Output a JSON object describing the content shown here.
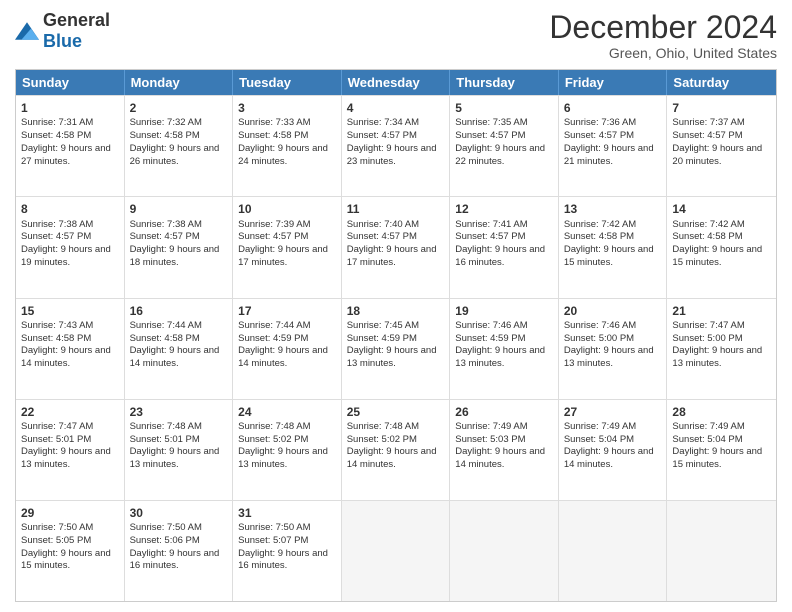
{
  "logo": {
    "general": "General",
    "blue": "Blue"
  },
  "header": {
    "month": "December 2024",
    "location": "Green, Ohio, United States"
  },
  "days": [
    "Sunday",
    "Monday",
    "Tuesday",
    "Wednesday",
    "Thursday",
    "Friday",
    "Saturday"
  ],
  "weeks": [
    [
      {
        "day": "1",
        "sunrise": "7:31 AM",
        "sunset": "4:58 PM",
        "daylight": "9 hours and 27 minutes."
      },
      {
        "day": "2",
        "sunrise": "7:32 AM",
        "sunset": "4:58 PM",
        "daylight": "9 hours and 26 minutes."
      },
      {
        "day": "3",
        "sunrise": "7:33 AM",
        "sunset": "4:58 PM",
        "daylight": "9 hours and 24 minutes."
      },
      {
        "day": "4",
        "sunrise": "7:34 AM",
        "sunset": "4:57 PM",
        "daylight": "9 hours and 23 minutes."
      },
      {
        "day": "5",
        "sunrise": "7:35 AM",
        "sunset": "4:57 PM",
        "daylight": "9 hours and 22 minutes."
      },
      {
        "day": "6",
        "sunrise": "7:36 AM",
        "sunset": "4:57 PM",
        "daylight": "9 hours and 21 minutes."
      },
      {
        "day": "7",
        "sunrise": "7:37 AM",
        "sunset": "4:57 PM",
        "daylight": "9 hours and 20 minutes."
      }
    ],
    [
      {
        "day": "8",
        "sunrise": "7:38 AM",
        "sunset": "4:57 PM",
        "daylight": "9 hours and 19 minutes."
      },
      {
        "day": "9",
        "sunrise": "7:38 AM",
        "sunset": "4:57 PM",
        "daylight": "9 hours and 18 minutes."
      },
      {
        "day": "10",
        "sunrise": "7:39 AM",
        "sunset": "4:57 PM",
        "daylight": "9 hours and 17 minutes."
      },
      {
        "day": "11",
        "sunrise": "7:40 AM",
        "sunset": "4:57 PM",
        "daylight": "9 hours and 17 minutes."
      },
      {
        "day": "12",
        "sunrise": "7:41 AM",
        "sunset": "4:57 PM",
        "daylight": "9 hours and 16 minutes."
      },
      {
        "day": "13",
        "sunrise": "7:42 AM",
        "sunset": "4:58 PM",
        "daylight": "9 hours and 15 minutes."
      },
      {
        "day": "14",
        "sunrise": "7:42 AM",
        "sunset": "4:58 PM",
        "daylight": "9 hours and 15 minutes."
      }
    ],
    [
      {
        "day": "15",
        "sunrise": "7:43 AM",
        "sunset": "4:58 PM",
        "daylight": "9 hours and 14 minutes."
      },
      {
        "day": "16",
        "sunrise": "7:44 AM",
        "sunset": "4:58 PM",
        "daylight": "9 hours and 14 minutes."
      },
      {
        "day": "17",
        "sunrise": "7:44 AM",
        "sunset": "4:59 PM",
        "daylight": "9 hours and 14 minutes."
      },
      {
        "day": "18",
        "sunrise": "7:45 AM",
        "sunset": "4:59 PM",
        "daylight": "9 hours and 13 minutes."
      },
      {
        "day": "19",
        "sunrise": "7:46 AM",
        "sunset": "4:59 PM",
        "daylight": "9 hours and 13 minutes."
      },
      {
        "day": "20",
        "sunrise": "7:46 AM",
        "sunset": "5:00 PM",
        "daylight": "9 hours and 13 minutes."
      },
      {
        "day": "21",
        "sunrise": "7:47 AM",
        "sunset": "5:00 PM",
        "daylight": "9 hours and 13 minutes."
      }
    ],
    [
      {
        "day": "22",
        "sunrise": "7:47 AM",
        "sunset": "5:01 PM",
        "daylight": "9 hours and 13 minutes."
      },
      {
        "day": "23",
        "sunrise": "7:48 AM",
        "sunset": "5:01 PM",
        "daylight": "9 hours and 13 minutes."
      },
      {
        "day": "24",
        "sunrise": "7:48 AM",
        "sunset": "5:02 PM",
        "daylight": "9 hours and 13 minutes."
      },
      {
        "day": "25",
        "sunrise": "7:48 AM",
        "sunset": "5:02 PM",
        "daylight": "9 hours and 14 minutes."
      },
      {
        "day": "26",
        "sunrise": "7:49 AM",
        "sunset": "5:03 PM",
        "daylight": "9 hours and 14 minutes."
      },
      {
        "day": "27",
        "sunrise": "7:49 AM",
        "sunset": "5:04 PM",
        "daylight": "9 hours and 14 minutes."
      },
      {
        "day": "28",
        "sunrise": "7:49 AM",
        "sunset": "5:04 PM",
        "daylight": "9 hours and 15 minutes."
      }
    ],
    [
      {
        "day": "29",
        "sunrise": "7:50 AM",
        "sunset": "5:05 PM",
        "daylight": "9 hours and 15 minutes."
      },
      {
        "day": "30",
        "sunrise": "7:50 AM",
        "sunset": "5:06 PM",
        "daylight": "9 hours and 16 minutes."
      },
      {
        "day": "31",
        "sunrise": "7:50 AM",
        "sunset": "5:07 PM",
        "daylight": "9 hours and 16 minutes."
      },
      null,
      null,
      null,
      null
    ]
  ]
}
